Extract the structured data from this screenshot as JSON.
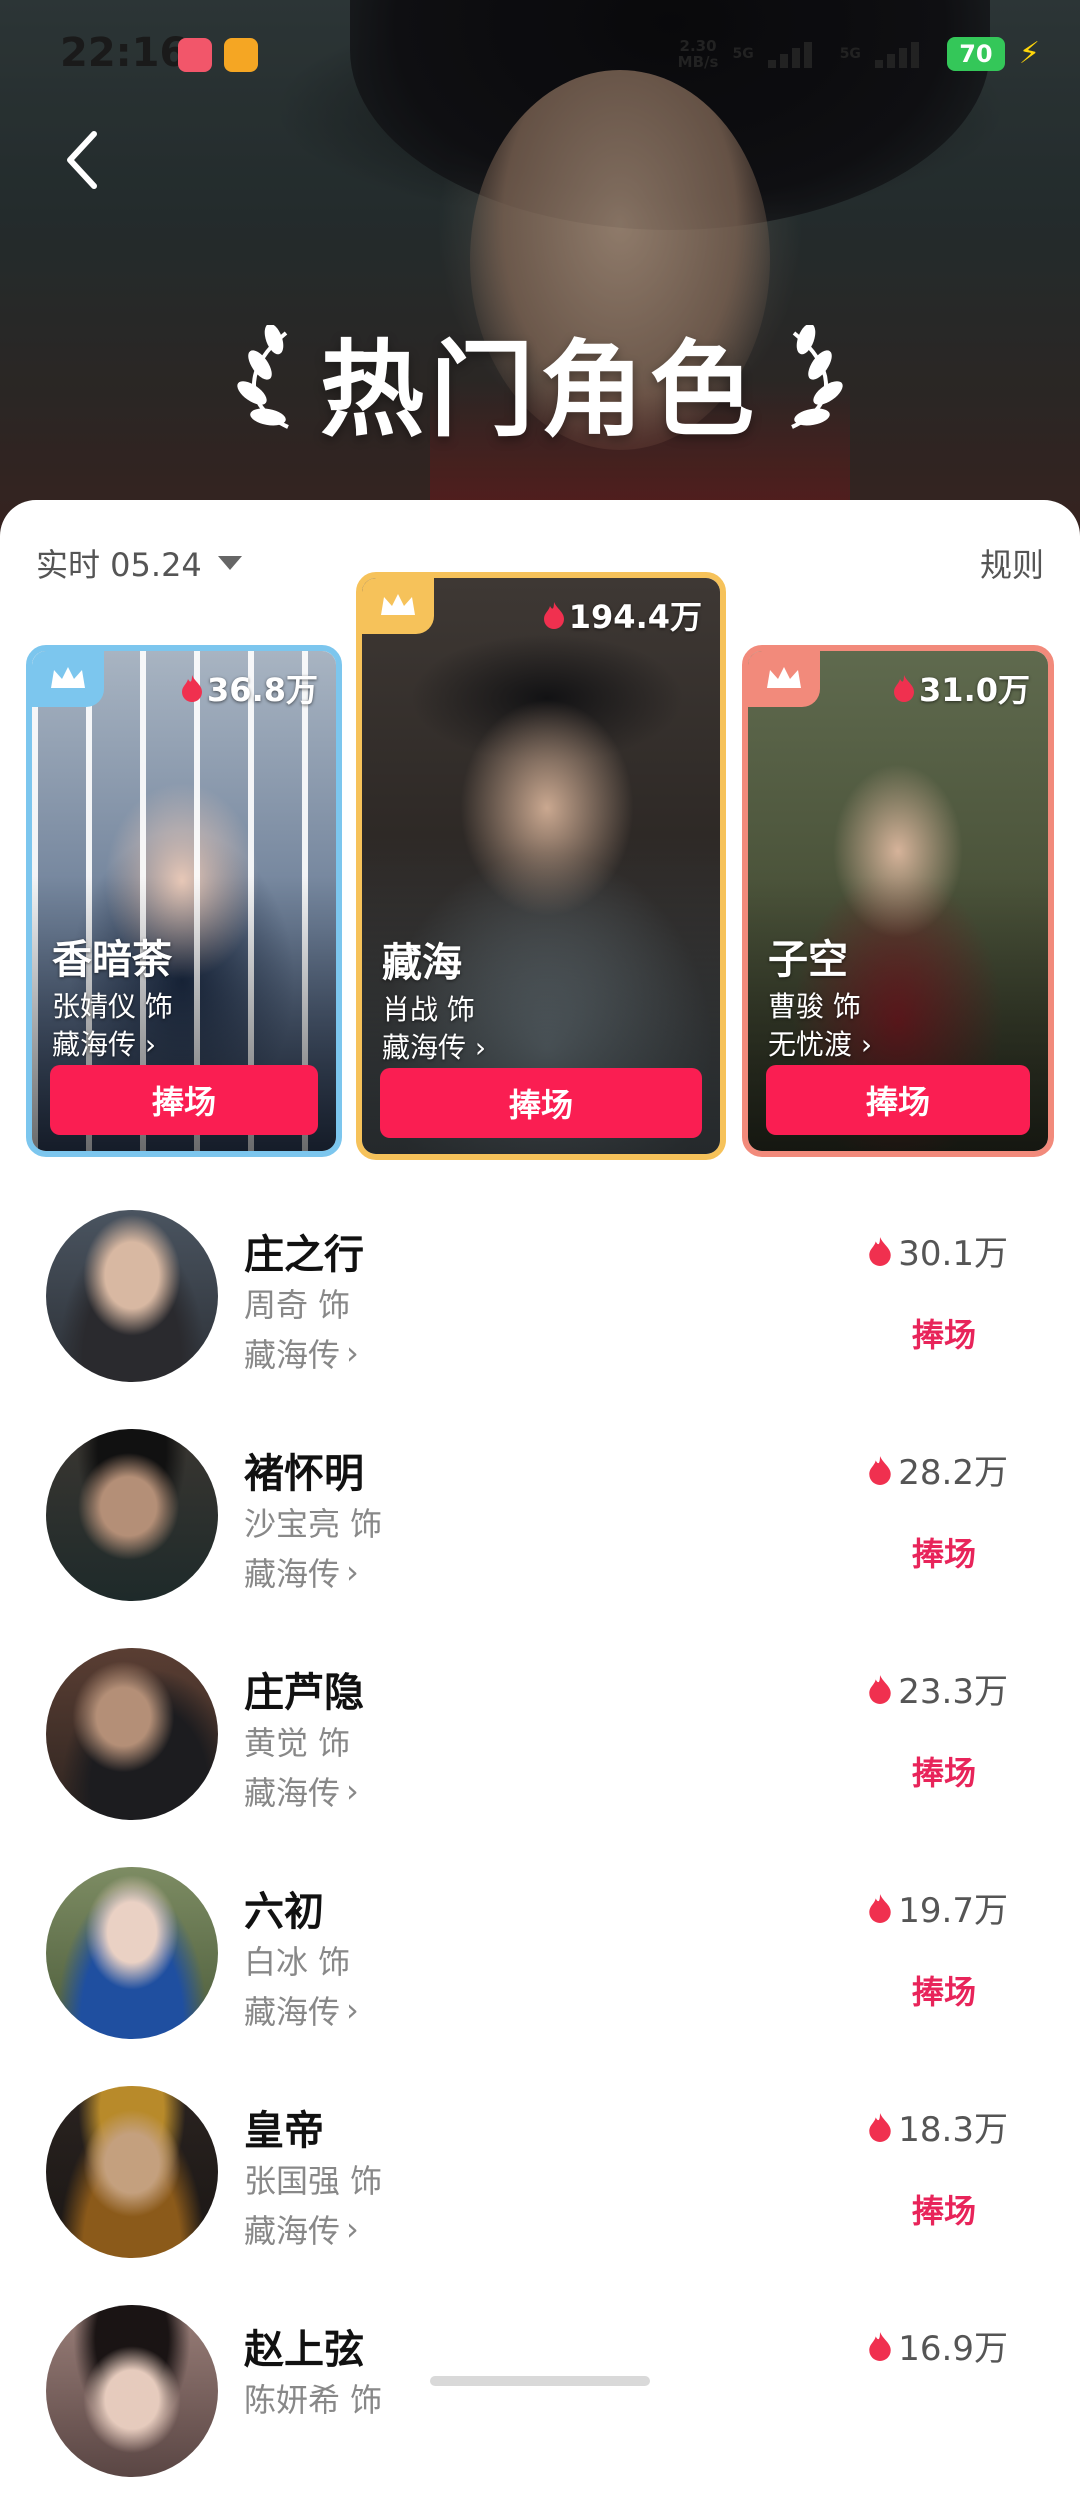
{
  "status_bar": {
    "time": "22:16",
    "speed_value": "2.30",
    "speed_unit": "MB/s",
    "net1": "5G",
    "net2": "5G",
    "battery": "70"
  },
  "header": {
    "title": "热门角色",
    "back_icon": "chevron-left-icon"
  },
  "filters": {
    "date_label": "实时 05.24",
    "rules_label": "规则"
  },
  "top3": [
    {
      "rank": 2,
      "role": "香暗荼",
      "actor": "张婧仪 饰",
      "drama": "藏海传",
      "heat": "36.8万",
      "button": "捧场",
      "accent": "#7cc6ee"
    },
    {
      "rank": 1,
      "role": "藏海",
      "actor": "肖战 饰",
      "drama": "藏海传",
      "heat": "194.4万",
      "button": "捧场",
      "accent": "#f6c25a"
    },
    {
      "rank": 3,
      "role": "子空",
      "actor": "曹骏 饰",
      "drama": "无忧渡",
      "heat": "31.0万",
      "button": "捧场",
      "accent": "#f28a7b"
    }
  ],
  "ranking": [
    {
      "role": "庄之行",
      "actor": "周奇 饰",
      "drama": "藏海传",
      "heat": "30.1万",
      "button": "捧场"
    },
    {
      "role": "褚怀明",
      "actor": "沙宝亮 饰",
      "drama": "藏海传",
      "heat": "28.2万",
      "button": "捧场"
    },
    {
      "role": "庄芦隐",
      "actor": "黄觉 饰",
      "drama": "藏海传",
      "heat": "23.3万",
      "button": "捧场"
    },
    {
      "role": "六初",
      "actor": "白冰 饰",
      "drama": "藏海传",
      "heat": "19.7万",
      "button": "捧场"
    },
    {
      "role": "皇帝",
      "actor": "张国强 饰",
      "drama": "藏海传",
      "heat": "18.3万",
      "button": "捧场"
    },
    {
      "role": "赵上弦",
      "actor": "陈妍希 饰",
      "drama": "",
      "heat": "16.9万",
      "button": ""
    }
  ],
  "colors": {
    "support_red": "#fa1e52",
    "support_text": "#e8245a",
    "flame": "#f0304f"
  }
}
